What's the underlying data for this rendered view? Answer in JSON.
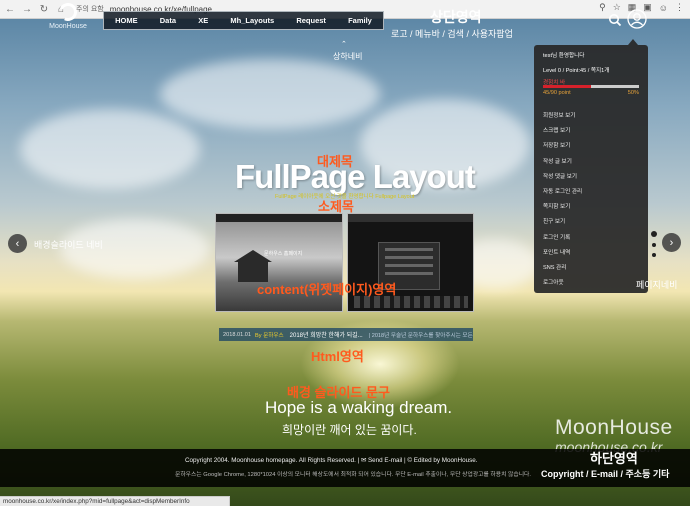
{
  "browser": {
    "security_label": "주의 요함",
    "url": "moonhouse.co.kr/xe/fullpage"
  },
  "logo": {
    "text": "MoonHouse"
  },
  "gnb": {
    "items": [
      "HOME",
      "Data",
      "XE",
      "Mh_Layouts",
      "Request",
      "Family"
    ]
  },
  "annotations": {
    "top_area": "상단영역",
    "top_area_sub": "로고 / 메뉴바 / 검색 / 사용자팝업",
    "sub_nav": "상하네비",
    "title": "대제목",
    "subtitle": "소제목",
    "content": "content(위젯페이지)영역",
    "html": "Html영역",
    "slide_nav": "배경슬라이드 네비",
    "page_nav": "페이지네비",
    "bg_text": "배경 슬라이드 문구",
    "bottom_area": "하단영역",
    "bottom_area_sub": "Copyright / E-mail / 주소등 기타"
  },
  "member_panel": {
    "welcome": "test님 환영합니다",
    "level": "Level 0 / Point:45 / 쪽지1개",
    "exp_label": "경험치 바",
    "exp_left": "45/90 point",
    "exp_right": "50%",
    "exp_fraction": 0.5,
    "menu": [
      "회원정보 보기",
      "스크랩 보기",
      "저장함 보기",
      "작성 글 보기",
      "작성 댓글 보기",
      "자동 로그인 관리",
      "쪽지함 보기",
      "친구 보기",
      "로그인 기록",
      "포인트 내역",
      "SNS 관리",
      "로그아웃"
    ]
  },
  "headline": {
    "title": "FullPage Layout",
    "subtitle_small": "FullPage 레이아웃에 오신 것을 환영합니다 Fullpage Layout"
  },
  "thumbs": {
    "left_caption": "문하우스 홈페이지"
  },
  "ticker": {
    "date": "2018.01.01",
    "author": "By 문하우스",
    "title1": "2018년 희망찬 한해가 되길...",
    "title2": "| 2018년 무술년 문하우스를 찾아주시는 모든 분"
  },
  "hero": {
    "line1": "Hope is a waking dream.",
    "line2": "희망이란 깨어 있는 꿈이다."
  },
  "watermark": {
    "line1": "MoonHouse",
    "line2": "moonhouse.co.kr"
  },
  "footer": {
    "line1": "Copyright 2004. Moonhouse homepage. All Rights Reserved. | ✉ Send E-mail | © Edited by MoonHouse.",
    "line2": "문하우스는 Google Chrome, 1280*1024 이상의 모니터 해상도에서 최적화 되어 있습니다. 무단 E-mail 추출이나, 무단 상업광고를 하용치 않습니다."
  },
  "status_bar": {
    "text": "moonhouse.co.kr/xe/index.php?mid=fullpage&act=dispMemberInfo"
  }
}
